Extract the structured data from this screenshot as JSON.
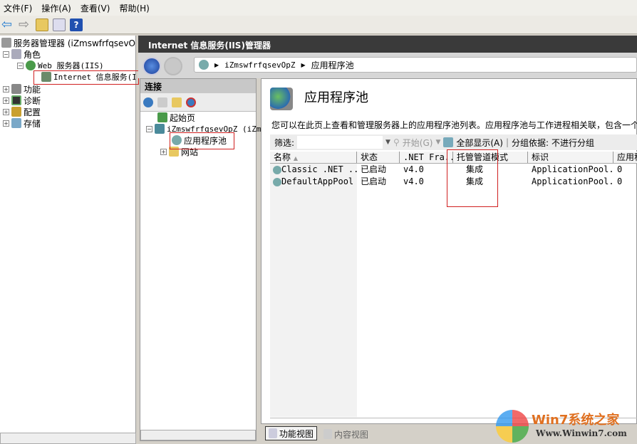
{
  "menu": [
    "文件(F)",
    "操作(A)",
    "查看(V)",
    "帮助(H)"
  ],
  "left_tree": {
    "root": "服务器管理器 (iZmswfrfqsevOp",
    "roles": "角色",
    "web_server": "Web 服务器(IIS)",
    "iis": "Internet 信息服务(I",
    "features": "功能",
    "diagnostics": "诊断",
    "config": "配置",
    "storage": "存储"
  },
  "iis_title": "Internet 信息服务(IIS)管理器",
  "breadcrumb": [
    "iZmswfrfqsevOpZ",
    "应用程序池"
  ],
  "connections": {
    "title": "连接",
    "start_page": "起始页",
    "server": "iZmswfrfqsevOpZ (iZm",
    "app_pools": "应用程序池",
    "sites": "网站"
  },
  "main": {
    "title": "应用程序池",
    "description": "您可以在此页上查看和管理服务器上的应用程序池列表。应用程序池与工作进程相关联，包含一个",
    "filter_label": "筛选:",
    "filter_value": "",
    "start_label": "开始(G)",
    "show_all_label": "全部显示(A)",
    "group_label": "分组依据:",
    "group_value": "不进行分组",
    "columns": [
      "名称",
      "状态",
      ".NET Fra...",
      "托管管道模式",
      "标识",
      "应用程"
    ],
    "rows": [
      [
        "Classic .NET ...",
        "已启动",
        "v4.0",
        "集成",
        "ApplicationPool...",
        "0"
      ],
      [
        "DefaultAppPool",
        "已启动",
        "v4.0",
        "集成",
        "ApplicationPool...",
        "0"
      ]
    ]
  },
  "bottom": {
    "features_view": "功能视图",
    "content_view": "内容视图"
  },
  "watermark": {
    "brand": "Win7系统之家",
    "url": "Www.Winwin7.com"
  }
}
